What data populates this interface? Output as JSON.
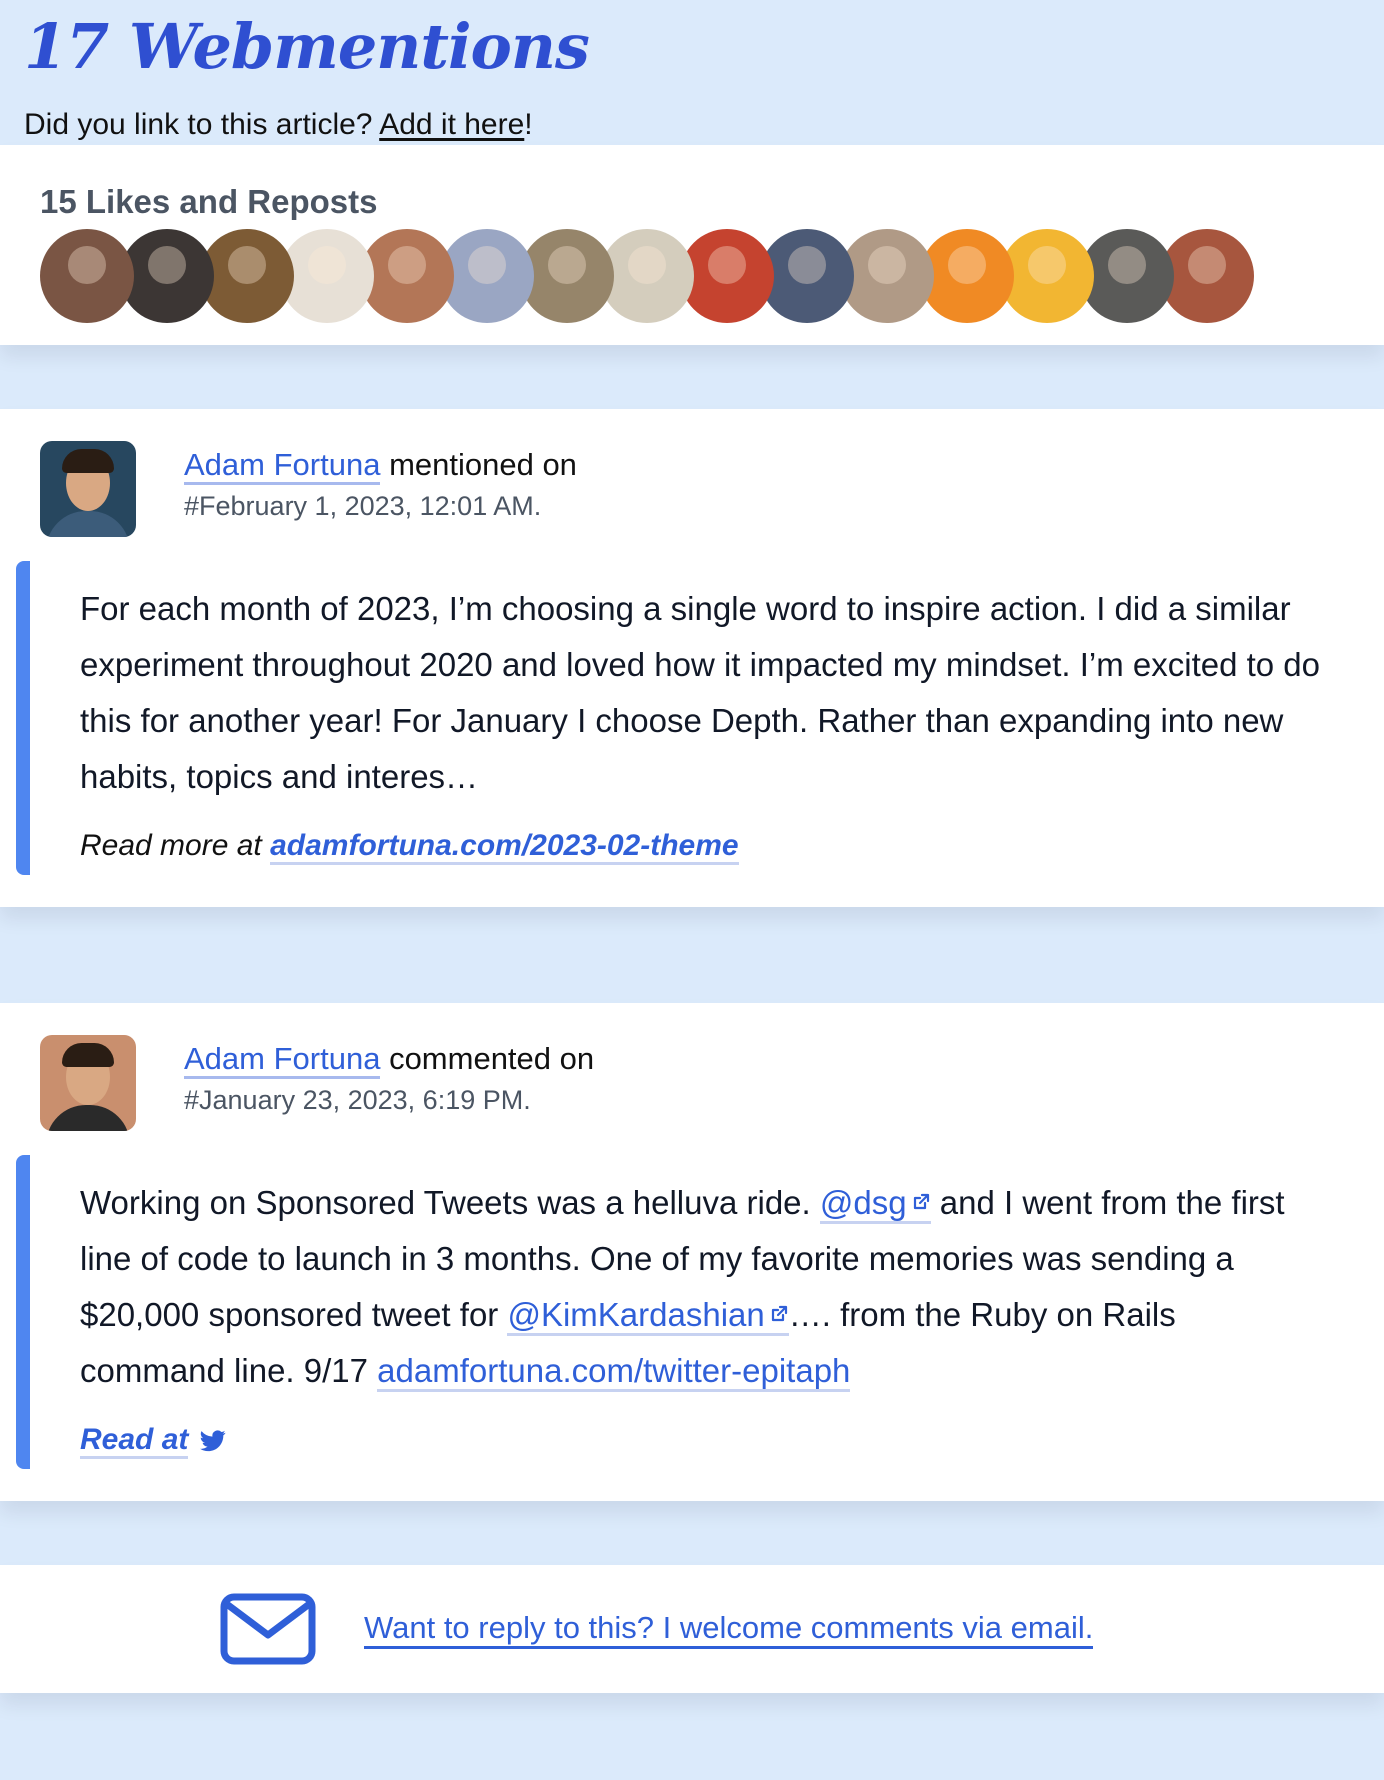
{
  "header": {
    "title": "17 Webmentions",
    "prompt_text": "Did you link to this article?",
    "add_link": "Add it here",
    "punct": "!"
  },
  "likes": {
    "title": "15 Likes and Reposts",
    "avatar_colors": [
      "#7a5544",
      "#3c3634",
      "#7d5b35",
      "#e7e0d6",
      "#b37657",
      "#9aa6c3",
      "#96856a",
      "#d4cdbd",
      "#c5432f",
      "#4c5a76",
      "#b09a86",
      "#f08a24",
      "#f2b632",
      "#5a5a58",
      "#a7563e"
    ]
  },
  "mentions": [
    {
      "author": "Adam Fortuna",
      "action": "mentioned on",
      "date": "#February 1, 2023, 12:01 AM.",
      "body": "For each month of 2023, I’m choosing a single word to inspire action. I did a similar experiment throughout 2020 and loved how it impacted my mindset. I’m excited to do this for another year! For January I choose Depth. Rather than expanding into new habits, topics and interes…",
      "read_more_prefix": "Read more at",
      "read_more_link": "adamfortuna.com/2023-02-theme"
    },
    {
      "author": "Adam Fortuna",
      "action": "commented on",
      "date": "#January 23, 2023, 6:19 PM.",
      "body_part1": "Working on Sponsored Tweets was a helluva ride.",
      "mention1": "@dsg",
      "body_part2": "and I went from the first line of code to launch in 3 months. One of my favorite memories was sending a $20,000 sponsored tweet for",
      "mention2": "@KimKardashian",
      "body_part3": "…. from the Ruby on Rails command line. 9/17",
      "link": "adamfortuna.com/twitter-epitaph",
      "read_at": "Read at"
    }
  ],
  "email": {
    "label": "Want to reply to this? I welcome comments via email."
  },
  "colors": {
    "accent": "#2f5fd8",
    "title": "#2f4fd1",
    "quote_border": "#4f86f0",
    "page_bg": "#dbeafb"
  }
}
